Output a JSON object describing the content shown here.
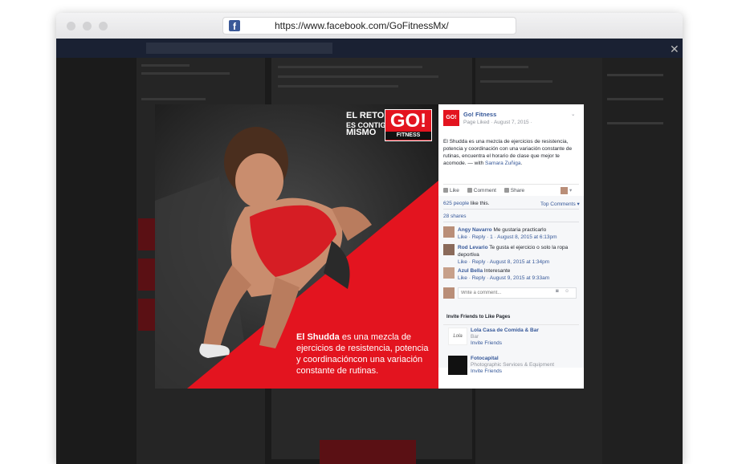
{
  "browser": {
    "url": "https://www.facebook.com/GoFitnessMx/",
    "favicon": "facebook-icon"
  },
  "overlay": {
    "close_glyph": "✕"
  },
  "photo": {
    "tagline_1": "EL RETO",
    "tagline_2": "ES CONTIGO",
    "tagline_3": "MISMO",
    "logo_main": "GO!",
    "logo_sub": "FITNESS",
    "caption_bold": "El Shudda",
    "caption_rest": " es una mezcla de ejercicios de resistencia, potencia y coordinacióncon una variación constante de rutinas."
  },
  "post": {
    "page_name": "Go! Fitness",
    "page_avatar_text": "GO!",
    "meta": "Page Liked · August 7, 2015 ·",
    "text": "El Shudda es una mezcla de ejercicios de resistencia, potencia y coordinación con una variación constante de rutinas, encuentra el horario de clase que mejor te acomode. — with",
    "tagged": "Samara Zuñiga",
    "tagged_end": ".",
    "actions": {
      "like": "Like",
      "comment": "Comment",
      "share": "Share"
    },
    "likes_count": "625 people",
    "likes_suffix": " like this.",
    "top_comments": "Top Comments",
    "shares": "28 shares"
  },
  "comments": [
    {
      "name": "Angy Navarro",
      "text": "Me gustaria practicarlo",
      "meta": "Like · Reply · 1 · August 8, 2015 at 6:13pm"
    },
    {
      "name": "Rod Levario",
      "text": "Te gusta el ejercicio o solo la ropa deportiva",
      "meta": "Like · Reply · August 8, 2015 at 1:34pm"
    },
    {
      "name": "Azul Bella",
      "text": "Interesante",
      "meta": "Like · Reply · August 9, 2015 at 9:33am"
    }
  ],
  "comment_input": {
    "placeholder": "Write a comment..."
  },
  "invite": {
    "title": "Invite Friends to Like Pages",
    "pages": [
      {
        "name": "Lola Casa de Comida & Bar",
        "category": "Bar",
        "action": "Invite Friends"
      },
      {
        "name": "Fotocapital",
        "category": "Photographic Services & Equipment",
        "action": "Invite Friends"
      }
    ]
  },
  "colors": {
    "accent_red": "#e3141f",
    "facebook_blue": "#365899",
    "link_blue": "#4267b2"
  }
}
